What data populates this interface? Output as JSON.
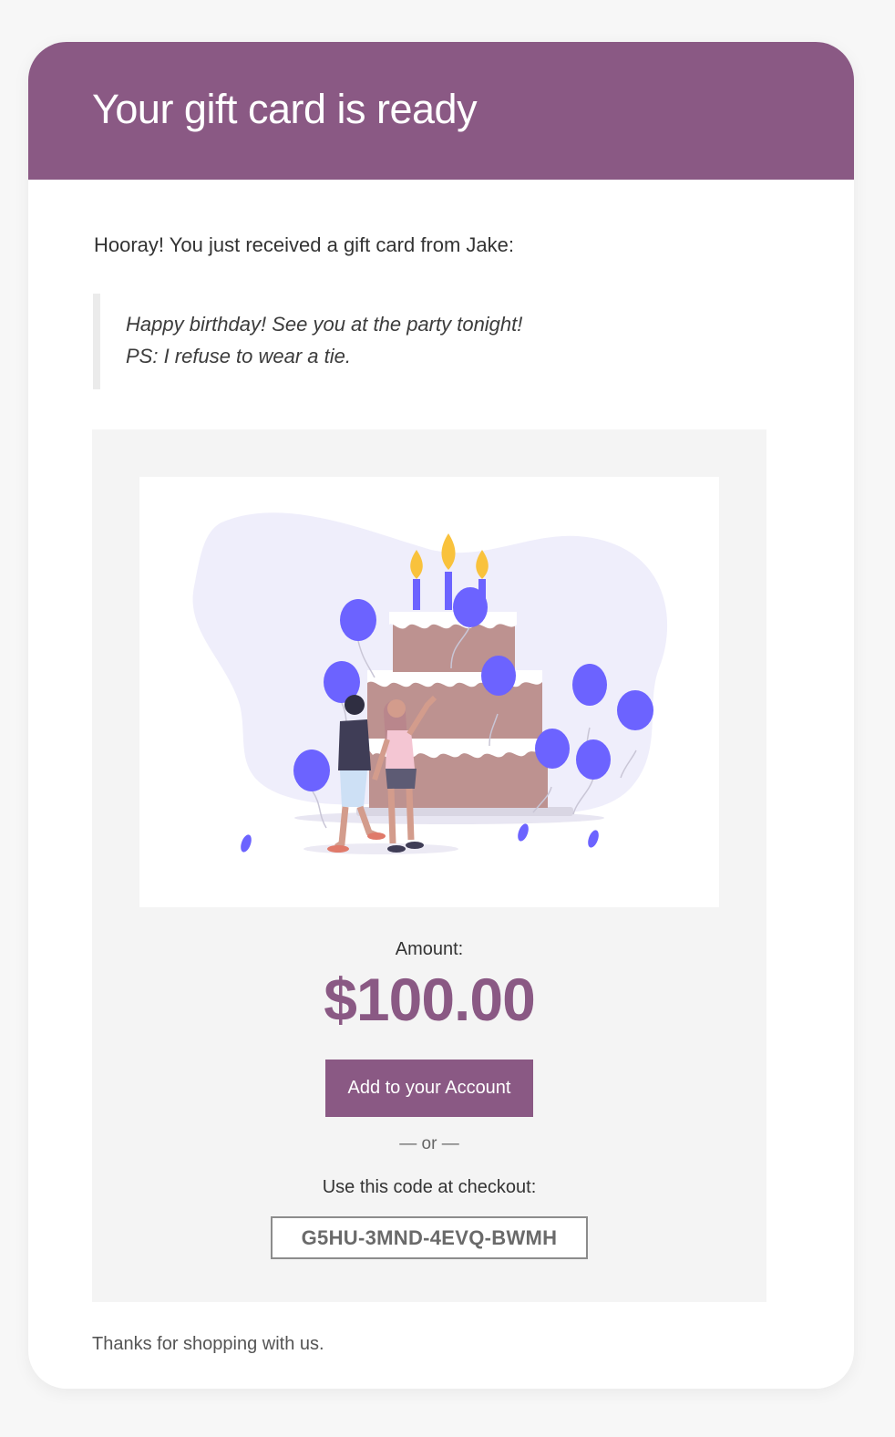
{
  "header": {
    "title": "Your gift card is ready",
    "background_color": "#8a5984"
  },
  "message": {
    "intro": "Hooray! You just received a gift card from Jake:",
    "quote_line_1": "Happy birthday! See you at the party tonight!",
    "quote_line_2": "PS: I refuse to wear a tie."
  },
  "gift_card": {
    "illustration": "birthday-cake-illustration",
    "amount_label": "Amount:",
    "amount": "$100.00",
    "add_button_label": "Add to your Account",
    "or_separator": "— or —",
    "code_label": "Use this code at checkout:",
    "code": "G5HU-3MND-4EVQ-BWMH",
    "accent_color": "#8a5984"
  },
  "footer": {
    "thanks": "Thanks for shopping with us."
  }
}
